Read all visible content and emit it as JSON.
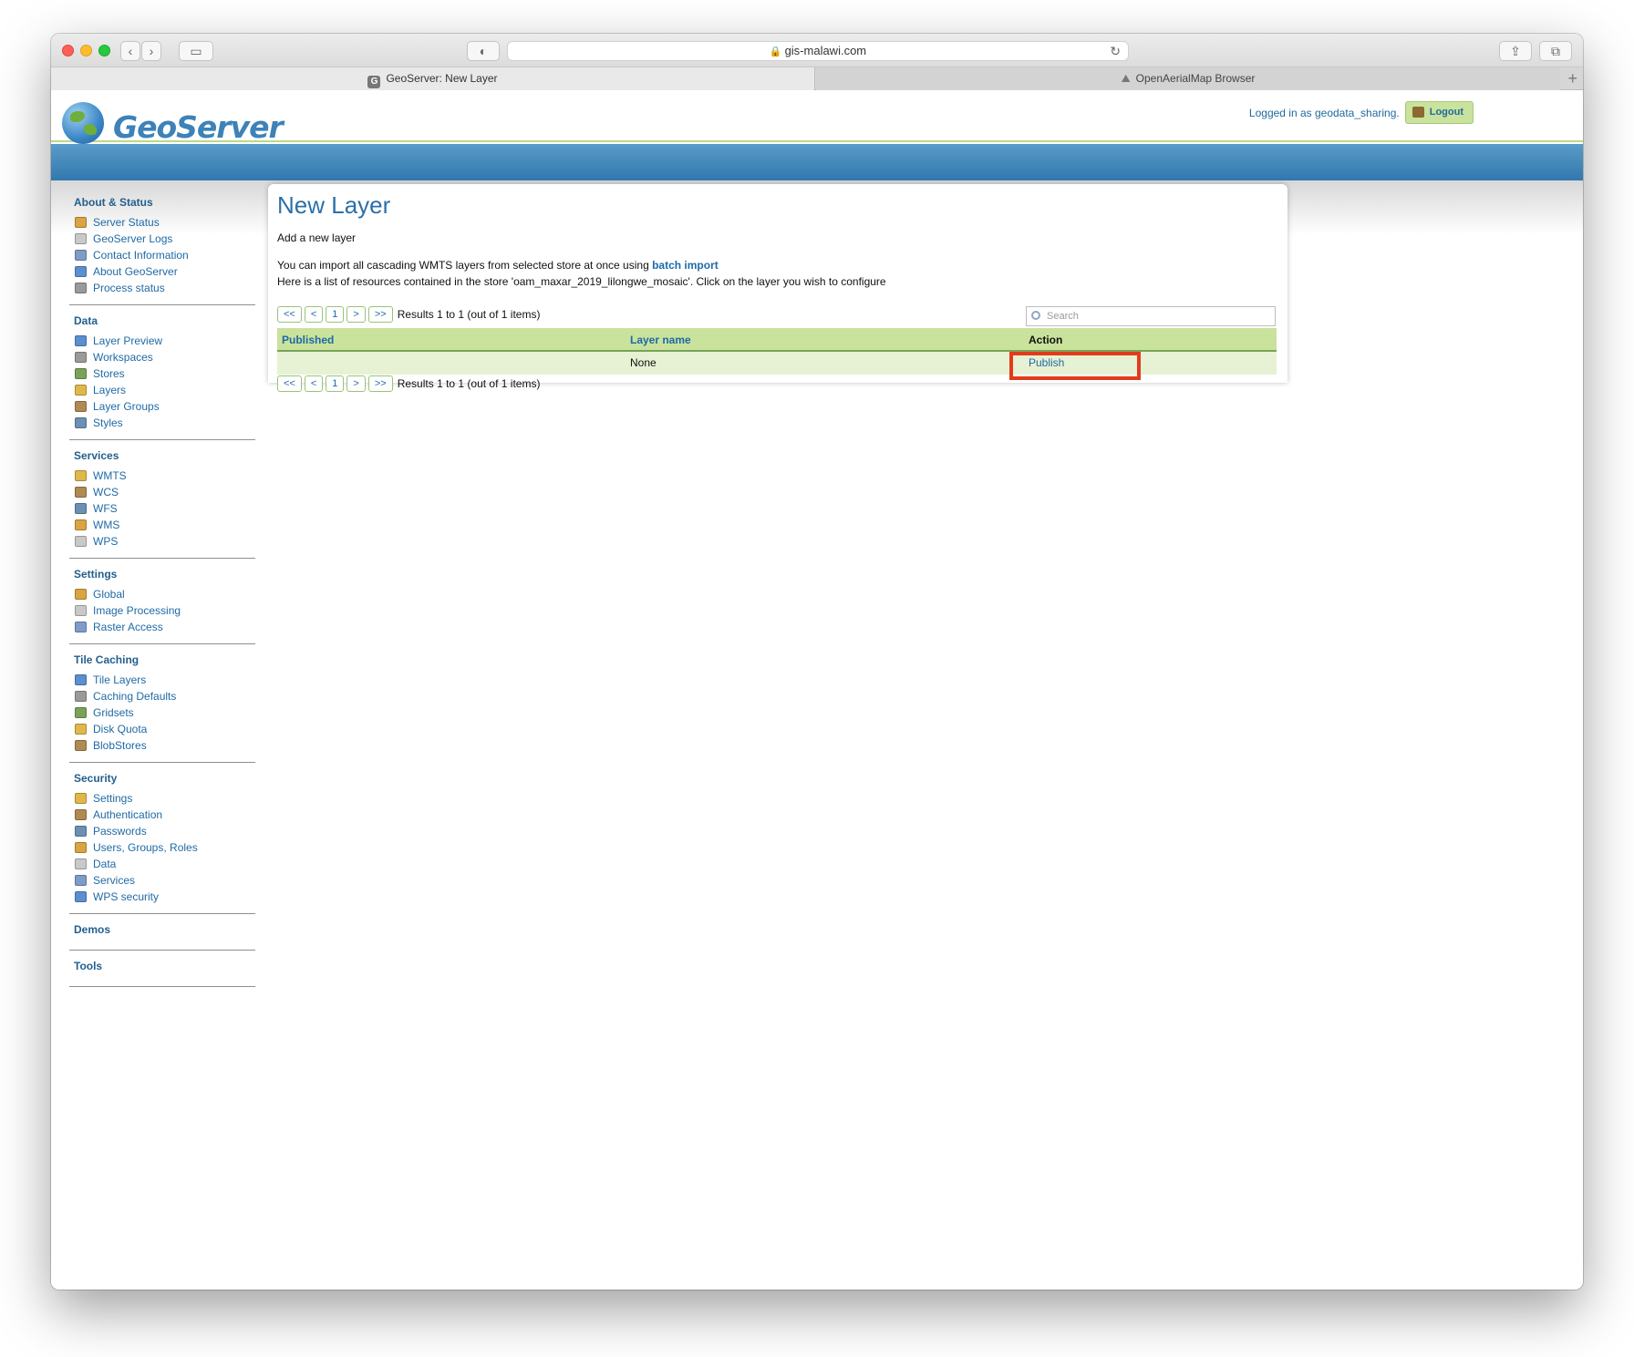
{
  "browser": {
    "url": "gis-malawi.com",
    "tabs": [
      {
        "label": "GeoServer: New Layer",
        "favicon": "G",
        "active": true
      },
      {
        "label": "OpenAerialMap Browser",
        "active": false
      }
    ]
  },
  "header": {
    "logo_text": "GeoServer",
    "login_text": "Logged in as geodata_sharing.",
    "logout_label": "Logout"
  },
  "sidebar": {
    "sections": [
      {
        "title": "About & Status",
        "items": [
          "Server Status",
          "GeoServer Logs",
          "Contact Information",
          "About GeoServer",
          "Process status"
        ]
      },
      {
        "title": "Data",
        "items": [
          "Layer Preview",
          "Workspaces",
          "Stores",
          "Layers",
          "Layer Groups",
          "Styles"
        ]
      },
      {
        "title": "Services",
        "items": [
          "WMTS",
          "WCS",
          "WFS",
          "WMS",
          "WPS"
        ]
      },
      {
        "title": "Settings",
        "items": [
          "Global",
          "Image Processing",
          "Raster Access"
        ]
      },
      {
        "title": "Tile Caching",
        "items": [
          "Tile Layers",
          "Caching Defaults",
          "Gridsets",
          "Disk Quota",
          "BlobStores"
        ]
      },
      {
        "title": "Security",
        "items": [
          "Settings",
          "Authentication",
          "Passwords",
          "Users, Groups, Roles",
          "Data",
          "Services",
          "WPS security"
        ]
      },
      {
        "title": "Demos",
        "items": []
      },
      {
        "title": "Tools",
        "items": []
      }
    ]
  },
  "content": {
    "title": "New Layer",
    "subtitle": "Add a new layer",
    "line1_prefix": "You can import all cascading WMTS layers from selected store at once using ",
    "line1_link": "batch import",
    "line2": "Here is a list of resources contained in the store 'oam_maxar_2019_lilongwe_mosaic'. Click on the layer you wish to configure",
    "pager": {
      "first": "<<",
      "prev": "<",
      "page": "1",
      "next": ">",
      "last": ">>",
      "results": "Results 1 to 1 (out of 1 items)"
    },
    "search_placeholder": "Search",
    "table": {
      "columns": [
        "Published",
        "Layer name",
        "Action"
      ],
      "rows": [
        {
          "published": "",
          "layer_name": "None",
          "action": "Publish"
        }
      ]
    }
  },
  "colors": {
    "accent_blue": "#3178ad",
    "header_green": "#c9e29c",
    "highlight": "#e23b1c"
  }
}
